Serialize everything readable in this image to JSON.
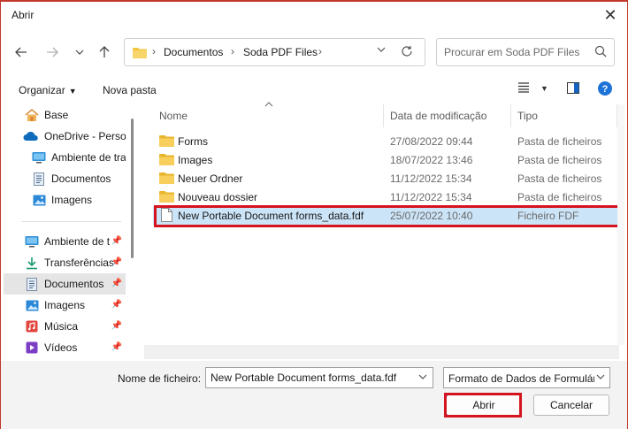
{
  "window": {
    "title": "Abrir"
  },
  "nav": {
    "breadcrumb": [
      "Documentos",
      "Soda PDF Files"
    ],
    "search_placeholder": "Procurar em Soda PDF Files"
  },
  "toolbar": {
    "organize": "Organizar",
    "new_folder": "Nova pasta"
  },
  "sidebar": {
    "items": [
      {
        "label": "Base",
        "icon": "home-icon"
      },
      {
        "label": "OneDrive - Persor",
        "icon": "cloud-icon"
      },
      {
        "label": "Ambiente de tra",
        "icon": "desktop-icon"
      },
      {
        "label": "Documentos",
        "icon": "document-icon"
      },
      {
        "label": "Imagens",
        "icon": "image-icon"
      },
      {
        "label": "Ambiente de t",
        "icon": "desktop-icon"
      },
      {
        "label": "Transferências",
        "icon": "download-icon"
      },
      {
        "label": "Documentos",
        "icon": "document-icon"
      },
      {
        "label": "Imagens",
        "icon": "image-icon"
      },
      {
        "label": "Música",
        "icon": "music-icon"
      },
      {
        "label": "Vídeos",
        "icon": "video-icon"
      }
    ]
  },
  "columns": {
    "name": "Nome",
    "date": "Data de modificação",
    "type": "Tipo"
  },
  "files": [
    {
      "name": "Forms",
      "date": "27/08/2022 09:44",
      "type": "Pasta de ficheiros",
      "icon": "folder-icon"
    },
    {
      "name": "Images",
      "date": "18/07/2022 13:46",
      "type": "Pasta de ficheiros",
      "icon": "folder-icon"
    },
    {
      "name": "Neuer Ordner",
      "date": "11/12/2022 15:34",
      "type": "Pasta de ficheiros",
      "icon": "folder-icon"
    },
    {
      "name": "Nouveau dossier",
      "date": "11/12/2022 15:34",
      "type": "Pasta de ficheiros",
      "icon": "folder-icon"
    },
    {
      "name": "New Portable Document forms_data.fdf",
      "date": "25/07/2022 10:40",
      "type": "Ficheiro FDF",
      "icon": "file-icon"
    }
  ],
  "footer": {
    "filename_label": "Nome de ficheiro:",
    "filename_value": "New Portable Document forms_data.fdf",
    "filter_value": "Formato de Dados de Formulár",
    "open_label": "Abrir",
    "cancel_label": "Cancelar"
  },
  "colors": {
    "accent": "#0067c0",
    "highlight": "#d4141e",
    "selection": "#cce4f7",
    "folder": "#f4c542"
  }
}
